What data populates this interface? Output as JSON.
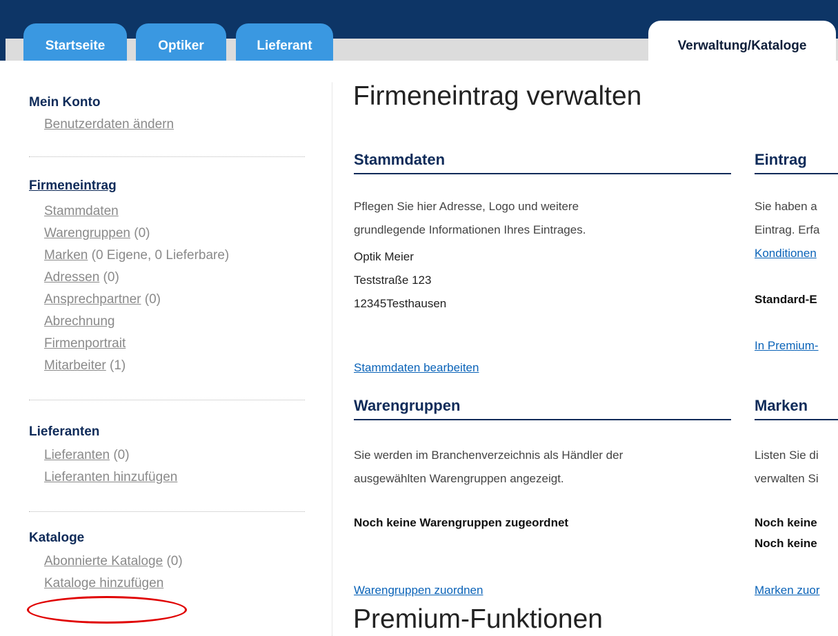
{
  "tabs": {
    "startseite": "Startseite",
    "optiker": "Optiker",
    "lieferant": "Lieferant",
    "verwaltung": "Verwaltung/Kataloge"
  },
  "sidebar": {
    "mein_konto": {
      "title": "Mein Konto",
      "items": [
        {
          "label": "Benutzerdaten ändern"
        }
      ]
    },
    "firmeneintrag": {
      "title": "Firmeneintrag",
      "items": [
        {
          "label": "Stammdaten",
          "count": ""
        },
        {
          "label": "Warengruppen",
          "count": " (0)"
        },
        {
          "label": "Marken",
          "count": " (0 Eigene, 0 Lieferbare)"
        },
        {
          "label": "Adressen",
          "count": " (0)"
        },
        {
          "label": "Ansprechpartner",
          "count": " (0)"
        },
        {
          "label": "Abrechnung",
          "count": ""
        },
        {
          "label": "Firmenportrait",
          "count": ""
        },
        {
          "label": "Mitarbeiter",
          "count": " (1)"
        }
      ]
    },
    "lieferanten": {
      "title": "Lieferanten",
      "items": [
        {
          "label": "Lieferanten",
          "count": " (0)"
        },
        {
          "label": "Lieferanten hinzufügen",
          "count": ""
        }
      ]
    },
    "kataloge": {
      "title": "Kataloge",
      "items": [
        {
          "label": "Abonnierte Kataloge",
          "count": " (0)"
        },
        {
          "label": "Kataloge hinzufügen",
          "count": ""
        }
      ]
    }
  },
  "main": {
    "title": "Firmeneintrag verwalten",
    "stammdaten": {
      "title": "Stammdaten",
      "desc1": "Pflegen Sie hier Adresse, Logo und weitere",
      "desc2": "grundlegende Informationen Ihres Eintrages.",
      "address1": "Optik Meier",
      "address2": "Teststraße 123",
      "address3": "12345Testhausen",
      "link": "Stammdaten bearbeiten"
    },
    "warengruppen": {
      "title": "Warengruppen",
      "desc1": "Sie werden im Branchenverzeichnis als Händler der",
      "desc2": "ausgewählten Warengruppen angezeigt.",
      "status": "Noch keine Warengruppen zugeordnet",
      "link": "Warengruppen zuordnen"
    },
    "eintrag": {
      "title": "Eintrag",
      "desc1": "Sie haben a",
      "desc2": "Eintrag. Erfa",
      "link1": "Konditionen",
      "bold": "Standard-E",
      "link2": "In Premium-"
    },
    "marken": {
      "title": "Marken",
      "desc1": "Listen Sie di",
      "desc2": "verwalten Si",
      "bold1": "Noch keine",
      "bold2": "Noch keine",
      "link": "Marken zuor"
    },
    "premium_title": "Premium-Funktionen"
  }
}
